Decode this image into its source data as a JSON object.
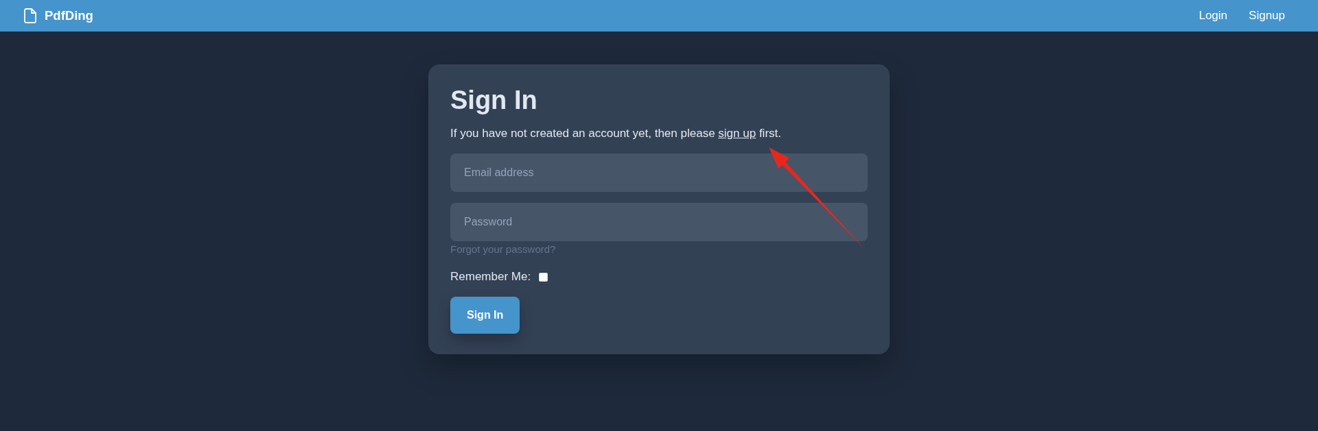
{
  "header": {
    "brand": "PdfDing",
    "nav": [
      {
        "label": "Login"
      },
      {
        "label": "Signup"
      }
    ]
  },
  "card": {
    "title": "Sign In",
    "intro": {
      "before": "If you have not created an account yet, then please",
      "link": "sign up",
      "after": "first."
    },
    "email_field": {
      "placeholder": "Email address"
    },
    "password_field": {
      "placeholder": "Password"
    },
    "forgot_link": "Forgot your password?",
    "remember": {
      "label": "Remember Me:",
      "checked": false
    },
    "submit": "Sign In"
  }
}
